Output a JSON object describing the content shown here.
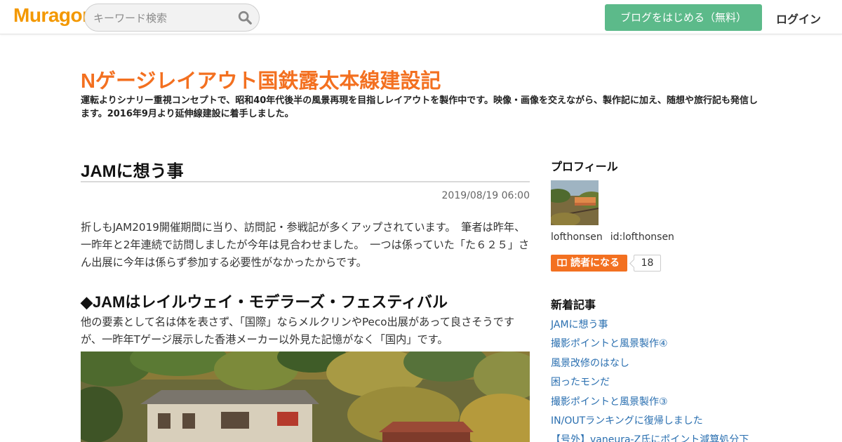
{
  "header": {
    "logo": "Muragon",
    "search_placeholder": "キーワード検索",
    "start_blog_label": "ブログをはじめる（無料）",
    "login_label": "ログイン"
  },
  "blog": {
    "title": "Nゲージレイアウト国鉄露太本線建設記",
    "description": "運転よりシナリー重視コンセプトで、昭和40年代後半の風景再現を目指しレイアウトを製作中です。映像・画像を交えながら、製作記に加え、随想や旅行記も発信します。2016年9月より延伸線建設に着手しました。"
  },
  "article": {
    "title": "JAMに想う事",
    "date": "2019/08/19 06:00",
    "paragraph1": "折しもJAM2019開催期間に当り、訪問記・参戦記が多くアップされています。　筆者は昨年、一昨年と2年連続で訪問しましたが今年は見合わせました。　一つは係っていた「た６２５」さん出展に今年は係らず参加する必要性がなかったからです。",
    "heading2": "◆JAMはレイルウェイ・モデラーズ・フェスティバル",
    "paragraph2": "他の要素として名は体を表さず、「国際」ならメルクリンやPeco出展があって良さそうですが、一昨年Tゲージ展示した香港メーカー以外見た記憶がなく「国内」です。"
  },
  "sidebar": {
    "profile_heading": "プロフィール",
    "display_name": "lofthonsen",
    "user_id": "id:lofthonsen",
    "reader_button_label": "読者になる",
    "reader_count": "18",
    "recent_heading": "新着記事",
    "recent_posts": [
      "JAMに想う事",
      "撮影ポイントと風景製作④",
      "風景改修のはなし",
      "困ったモンだ",
      "撮影ポイントと風景製作③",
      "IN/OUTランキングに復帰しました",
      "【号外】vaneura-Z氏にポイント減算処分下"
    ]
  },
  "colors": {
    "brand": "#f39800",
    "title_orange": "#f37020",
    "start_button": "#5cba8a",
    "link_blue": "#2a6fb0"
  },
  "icons": {
    "search": "search-icon",
    "book": "book-icon"
  }
}
